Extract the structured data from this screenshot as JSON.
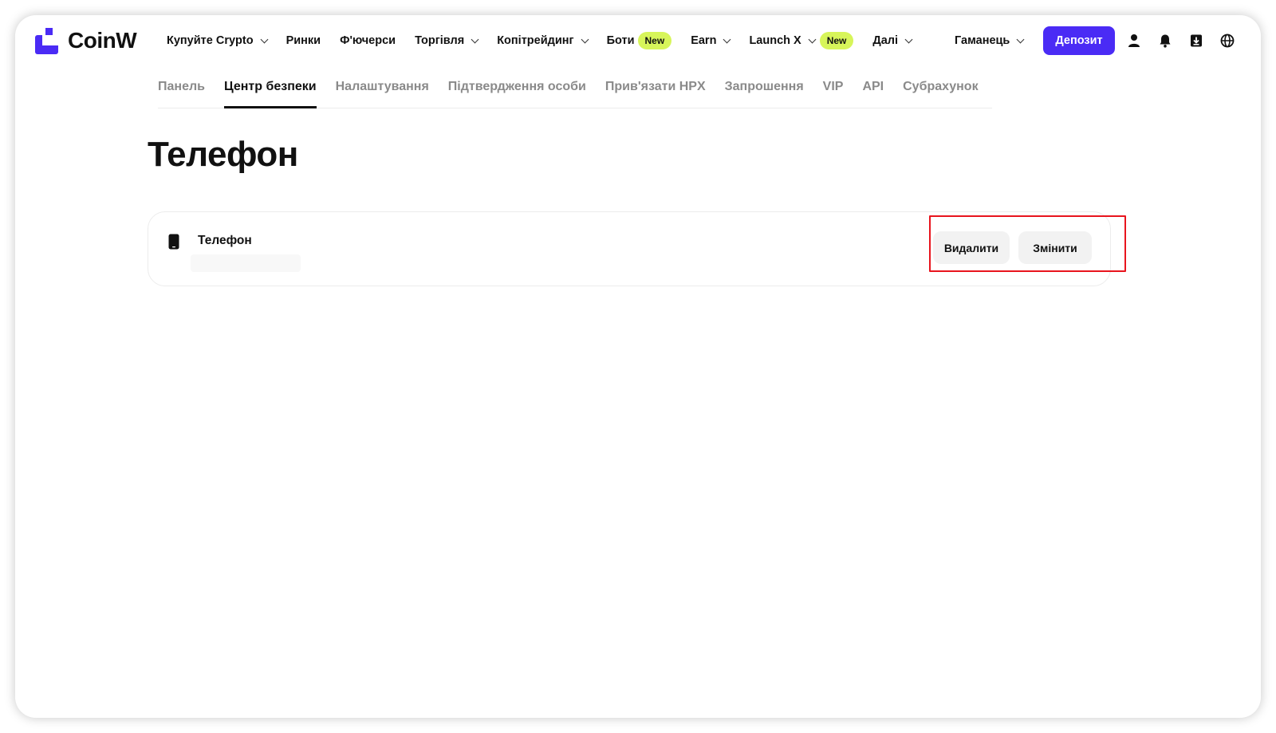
{
  "brand": {
    "name": "CoinW",
    "color": "#4a2bf5"
  },
  "nav": {
    "items": [
      {
        "label": "Купуйте Crypto",
        "dropdown": true
      },
      {
        "label": "Ринки",
        "dropdown": false
      },
      {
        "label": "Ф'ючерси",
        "dropdown": false
      },
      {
        "label": "Торгівля",
        "dropdown": true
      },
      {
        "label": "Копітрейдинг",
        "dropdown": true
      },
      {
        "label": "Боти",
        "dropdown": false,
        "badge": "New"
      },
      {
        "label": "Earn",
        "dropdown": true
      },
      {
        "label": "Launch X",
        "dropdown": true,
        "badge": "New"
      },
      {
        "label": "Далі",
        "dropdown": true
      }
    ],
    "wallet_label": "Гаманець",
    "deposit_label": "Депозит"
  },
  "header_icons": [
    "user-icon",
    "bell-icon",
    "download-icon",
    "globe-icon"
  ],
  "tabs": {
    "items": [
      "Панель",
      "Центр безпеки",
      "Налаштування",
      "Підтвердження особи",
      "Прив'язати HPX",
      "Запрошення",
      "VIP",
      "API",
      "Субрахунок"
    ],
    "active": "Центр безпеки"
  },
  "page": {
    "title": "Телефон",
    "card": {
      "icon": "phone-icon",
      "label": "Телефон",
      "delete_label": "Видалити",
      "change_label": "Змінити"
    }
  },
  "colors": {
    "new_badge": "#d7f55a",
    "highlight": "#e8141d"
  }
}
